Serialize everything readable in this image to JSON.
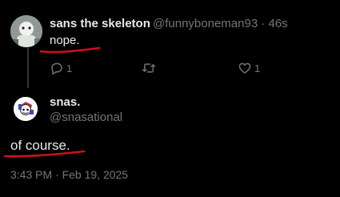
{
  "reply": {
    "author_name": "sans the skeleton",
    "author_handle": "@funnyboneman93",
    "separator": "·",
    "age": "46s",
    "text": "nope.",
    "actions": {
      "reply_count": "1",
      "repost_count": "",
      "like_count": "1"
    }
  },
  "main_post": {
    "author_name": "snas.",
    "author_handle": "@snasational",
    "text": "of course.",
    "timestamp": "3:43 PM · Feb 19, 2025"
  },
  "icons": {
    "reply": "reply-bubble-icon",
    "repost": "repost-arrows-icon",
    "like": "heart-icon"
  },
  "colors": {
    "background": "#000000",
    "primary_text": "#e7e9ea",
    "secondary_text": "#71767b",
    "annotation_underline": "#d10f1b"
  }
}
